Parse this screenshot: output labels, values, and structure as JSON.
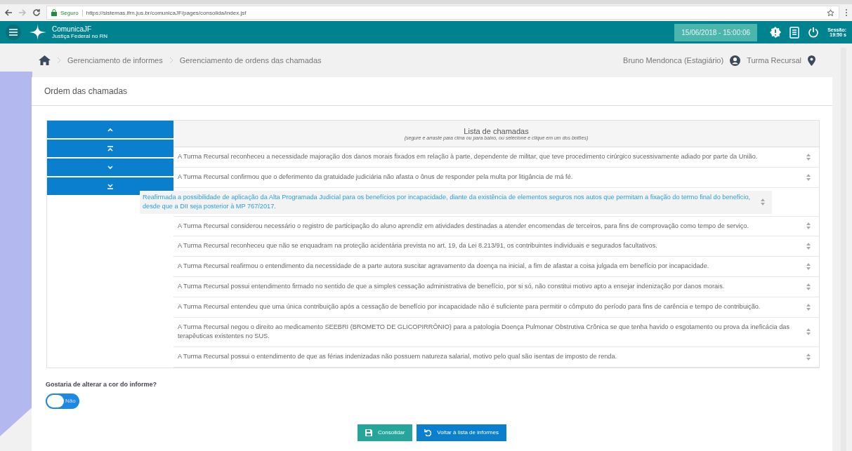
{
  "browser": {
    "security": "Seguro",
    "url": "https://sistemas.ifrn.jus.br/comunicaJF/pages/consolida/index.jsf"
  },
  "header": {
    "app_name": "ComunicaJF",
    "app_subtitle": "Justiça Federal no RN",
    "datetime": "15/06/2018 - 15:00:06",
    "session_label": "Sessão:",
    "session_time": "19:50 s"
  },
  "breadcrumb": [
    "Gerenciamento de informes",
    "Gerenciamento de ordens das chamadas"
  ],
  "user": "Bruno Mendonca (Estagiário)",
  "unit": "Turma Recursal",
  "card_title": "Ordem das chamadas",
  "move_buttons": [
    {
      "kind": "up"
    },
    {
      "kind": "top"
    },
    {
      "kind": "down"
    },
    {
      "kind": "bottom"
    }
  ],
  "list": {
    "title": "Lista de chamadas",
    "subtitle": "(segure e arraste para cima ou para baixo, ou selecione e clique em um dos botões)",
    "items": [
      {
        "text": "A Turma Recursal reconheceu a necessidade majoração dos danos morais fixados em relação à parte, dependente de militar, que teve procedimento cirúrgico sucessivamente adiado por parte da União."
      },
      {
        "text": "A Turma Recursal confirmou que o deferimento da gratuidade judiciária não afasta o ônus de responder pela multa por litigância de má fé."
      },
      {
        "kind": "placeholder"
      },
      {
        "text": "A Turma Recursal considerou necessário o registro de participação do aluno aprendiz em atividades destinadas a atender encomendas de terceiros, para fins de comprovação como tempo de serviço."
      },
      {
        "text": "A Turma Recursal reconheceu que não se enquadram na proteção acidentária prevista no art. 19, da Lei 8.213/91, os contribuintes individuais e segurados facultativos."
      },
      {
        "text": "A Turma Recursal reafirmou o entendimento da necessidade de a parte autora suscitar agravamento da doença na inicial, a fim de afastar a coisa julgada em benefício por incapacidade."
      },
      {
        "text": "A Turma Recursal possui entendimento firmado no sentido de que a simples cessação administrativa de benefício, por si só, não constitui motivo apto a ensejar indenização por danos morais."
      },
      {
        "text": "A Turma Recursal entendeu que uma única contribuição após a cessação de benefício por incapacidade não é suficiente para permitir o cômputo do período para fins de carência e tempo de contribuição."
      },
      {
        "text": "A Turma Recursal negou o direito ao medicamento SEEBRI (BROMETO DE GLICOPIRRÔNIO) para a patologia Doença Pulmonar Obstrutiva Crônica se que tenha havido o esgotamento ou prova da ineficácia das terapêuticas existentes no SUS."
      },
      {
        "text": "A Turma Recursal possui o entendimento de que as férias indenizadas não possuem natureza salarial, motivo pelo qual são isentas de imposto de renda."
      }
    ],
    "dragging": {
      "text": "Reafirmada a possibilidade de aplicação da Alta Programada Judicial para os benefícios por incapacidade, diante da existência de elementos seguros nos autos que permitam a fixação do termo final do benefício, desde que a DII seja posterior à MP 767/2017."
    }
  },
  "question": "Gostaria de alterar a cor do informe?",
  "toggle": {
    "on": false,
    "label": "Não"
  },
  "actions": [
    {
      "kind": "save",
      "label": "Consolidar"
    },
    {
      "kind": "back",
      "label": "Voltar à lista de informes"
    }
  ]
}
